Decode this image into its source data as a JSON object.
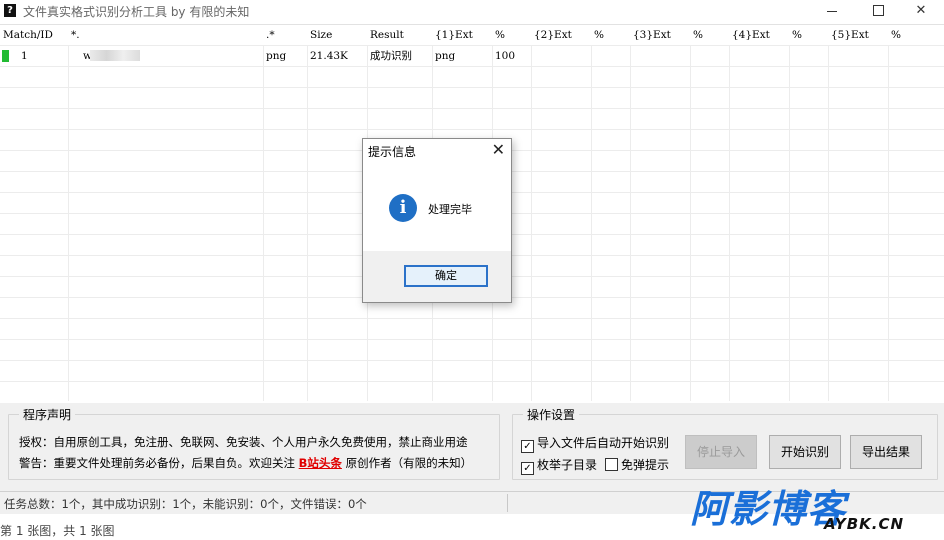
{
  "window": {
    "title": "文件真实格式识别分析工具 by 有限的未知",
    "app_icon": "?",
    "minimize_icon": "minimize-icon",
    "maximize_icon": "maximize-icon",
    "close_glyph": "✕"
  },
  "table": {
    "columns": [
      "Match/ID",
      "*.",
      ".*",
      "Size",
      "Result",
      "{1}Ext",
      "%",
      "{2}Ext",
      "%",
      "{3}Ext",
      "%",
      "{4}Ext",
      "%",
      "{5}Ext",
      "%"
    ],
    "rows": [
      {
        "id": "1",
        "name": "w",
        "ext": "png",
        "size": "21.43K",
        "result": "成功识别",
        "ext1": "png",
        "pct1": "100"
      }
    ]
  },
  "dialog": {
    "title": "提示信息",
    "close": "✕",
    "icon": "info-icon",
    "icon_glyph": "i",
    "message": "处理完毕",
    "ok": "确定"
  },
  "declaration": {
    "legend": "程序声明",
    "line1": "授权：自用原创工具，免注册、免联网、免安装、个人用户永久免费使用，禁止商业用途",
    "line2_pre": "警告：重要文件处理前务必备份，后果自负。欢迎关注 ",
    "line2_link": "B站头条",
    "line2_post": " 原创作者（有限的未知）"
  },
  "settings": {
    "legend": "操作设置",
    "auto_start": {
      "label": "导入文件后自动开始识别",
      "checked": true
    },
    "enum_subdir": {
      "label": "枚举子目录",
      "checked": true
    },
    "no_popup": {
      "label": "免弹提示",
      "checked": false
    },
    "stop_import": "停止导入",
    "start": "开始识别",
    "export": "导出结果"
  },
  "status": {
    "text": "任务总数：1个，其中成功识别：1个，未能识别：0个，文件错误：0个"
  },
  "viewer": {
    "text": "第 1 张图，共 1 张图"
  },
  "watermark": {
    "big": "阿影博客",
    "small": "AYBK.CN"
  },
  "colors": {
    "accent": "#2b72c9",
    "success_marker": "#22bb33",
    "link_red": "#e00000",
    "watermark_blue": "#1a6fd8"
  }
}
